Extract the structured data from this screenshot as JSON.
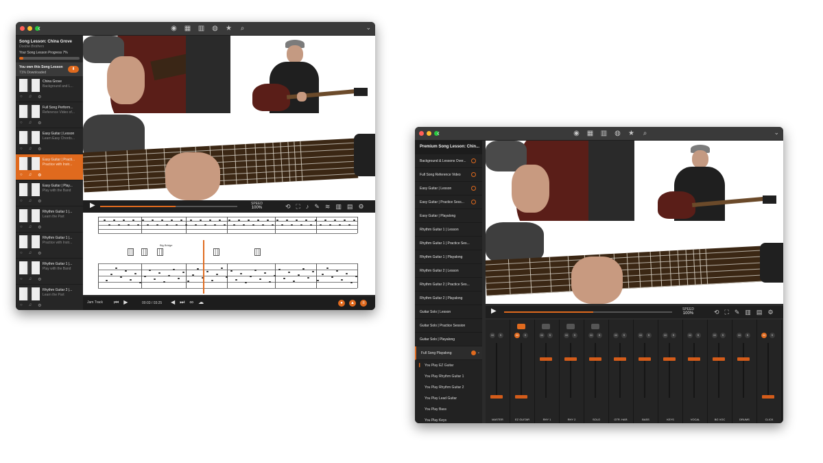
{
  "window1": {
    "sidebar": {
      "song_title": "Song Lesson: China Grove",
      "artist": "Doobie Brothers",
      "progress_label": "Your Song Lesson Progress 7%",
      "progress_value": 7,
      "own_title": "You own this Song Lesson",
      "own_status": "71% Downloaded",
      "items": [
        {
          "name": "China Grove",
          "sub": "Background and L..."
        },
        {
          "name": "Full Song Perform...",
          "sub": "Reference Video of..."
        },
        {
          "name": "Easy Guitar | Lesson",
          "sub": "Learn Easy Chords..."
        },
        {
          "name": "Easy Guitar | Practi...",
          "sub": "Practice with Instr..."
        },
        {
          "name": "Easy Guitar | Play...",
          "sub": "Play with the Band"
        },
        {
          "name": "Rhythm Guitar 1 |...",
          "sub": "Learn the Part"
        },
        {
          "name": "Rhythm Guitar 1 |...",
          "sub": "Practice with Instr..."
        },
        {
          "name": "Rhythm Guitar 1 |...",
          "sub": "Play with the Band"
        },
        {
          "name": "Rhythm Guitar 2 |...",
          "sub": "Learn the Part"
        }
      ]
    },
    "controls": {
      "speed_label": "SPEED",
      "speed_value": "100%"
    },
    "sheet": {
      "chord_label": "Big Bridge"
    },
    "transport": {
      "jam_label": "Jam Track",
      "time_current": "00:03",
      "time_total": "03:25"
    }
  },
  "window2": {
    "sidebar": {
      "title": "Premium Song Lesson: Chin...",
      "items": [
        "Background & Lessons Over...",
        "Full Song Reference Video",
        "Easy Guitar | Lesson",
        "Easy Guitar | Practice Sess...",
        "Easy Guitar | Playalong",
        "Rhythm Guitar 1 | Lesson",
        "Rhythm Guitar 1 | Practice Ses...",
        "Rhythm Guitar 1 | Playalong",
        "Rhythm Guitar 2 | Lesson",
        "Rhythm Guitar 2 | Practice Ses...",
        "Rhythm Guitar 2 | Playalong",
        "Guitar Solo | Lesson",
        "Guitar Solo | Practice Session",
        "Guitar Solo | Playalong",
        "Full Song Playalong"
      ],
      "subitems": [
        "You Play EZ Guitar",
        "You Play Rhythm Guitar 1",
        "You Play Rhythm Guitar 2",
        "You Play Lead Guitar",
        "You Play Bass",
        "You Play Keys"
      ]
    },
    "controls": {
      "speed_label": "SPEED",
      "speed_value": "100%"
    },
    "mixer": {
      "channels": [
        "MASTER",
        "EZ GUITAR",
        "RHY 1",
        "RHY 2",
        "SOLO",
        "GTR. HAR.",
        "BASS",
        "KEYS",
        "VOCAL",
        "BG VOC",
        "DRUMS",
        "CLICK"
      ]
    }
  },
  "icons": {
    "m": "M",
    "s": "S",
    "play": "▶",
    "back": "‹"
  },
  "colors": {
    "accent": "#e06a1e",
    "window_bg": "#2b2b2b"
  }
}
